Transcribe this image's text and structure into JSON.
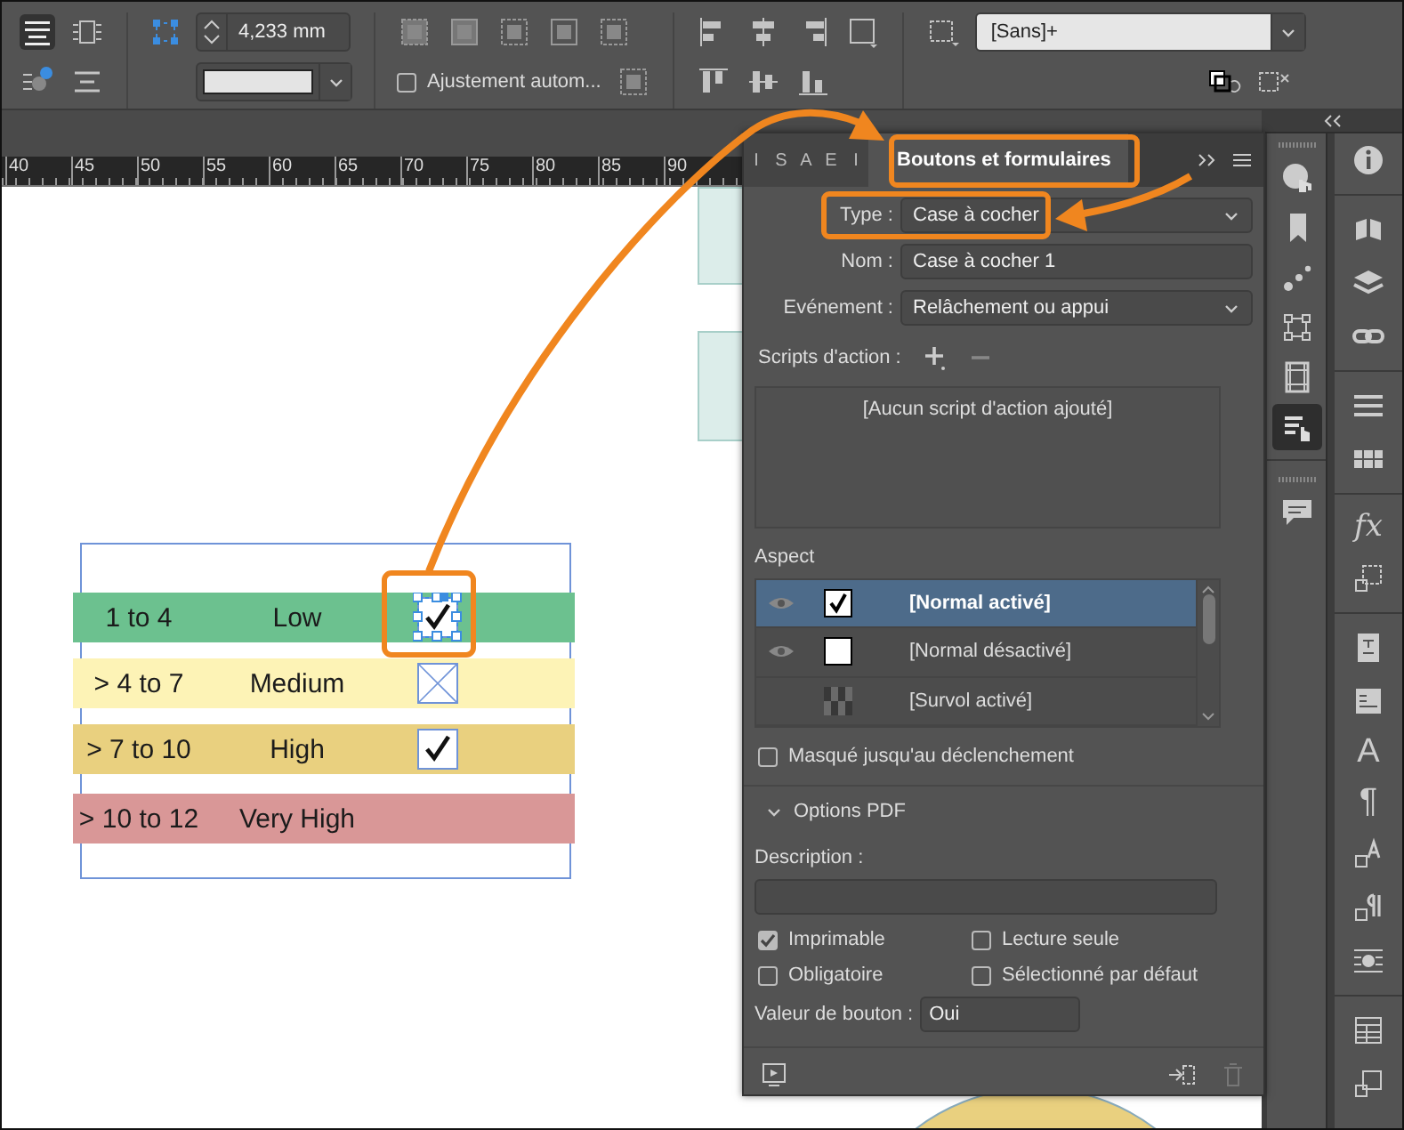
{
  "toolbar": {
    "stroke_weight": "4,233 mm",
    "auto_fit": {
      "label": "Ajustement autom...",
      "checked": false
    },
    "object_style": "[Sans]+"
  },
  "ruler": [
    "40",
    "45",
    "50",
    "55",
    "60",
    "65",
    "70",
    "75",
    "80",
    "85",
    "90"
  ],
  "canvas": {
    "rows": [
      {
        "range": "1 to 4",
        "rating": "Low",
        "color": "#6cc18f",
        "checkbox": {
          "checked": true,
          "selected": true
        }
      },
      {
        "range": "> 4 to 7",
        "rating": "Medium",
        "color": "#fdf3b6",
        "checkbox": {
          "checked": false,
          "selected": false
        }
      },
      {
        "range": "> 7 to 10",
        "rating": "High",
        "color": "#e9d07f",
        "checkbox": {
          "checked": true,
          "selected": false
        }
      },
      {
        "range": "> 10 to 12",
        "rating": "Very High",
        "color": "#d99797"
      }
    ]
  },
  "panel": {
    "tabs": [
      {
        "label": "I",
        "selected": false
      },
      {
        "label": "S",
        "selected": false
      },
      {
        "label": "A",
        "selected": false
      },
      {
        "label": "E",
        "selected": false
      },
      {
        "label": "I",
        "selected": false
      },
      {
        "label": "Boutons et formulaires",
        "selected": true
      }
    ],
    "fields": [
      {
        "kind": "dropdown",
        "label": "Type :",
        "value": "Case à cocher"
      },
      {
        "kind": "text",
        "label": "Nom :",
        "value": "Case à cocher 1"
      },
      {
        "kind": "dropdown",
        "label": "Evénement :",
        "value": "Relâchement ou appui"
      }
    ],
    "scripts": {
      "label": "Scripts d'action :",
      "empty_text": "[Aucun script d'action ajouté]"
    },
    "appearance": {
      "label": "Aspect",
      "states": [
        {
          "label": "[Normal activé]",
          "selected": true,
          "visible": true,
          "kind": "checked"
        },
        {
          "label": "[Normal désactivé]",
          "selected": false,
          "visible": true,
          "kind": "blank"
        },
        {
          "label": "[Survol activé]",
          "selected": false,
          "visible": false,
          "kind": "empty"
        }
      ]
    },
    "hidden_until_triggered": {
      "label": "Masqué jusqu'au déclenchement",
      "checked": false
    },
    "pdf_options": {
      "title": "Options PDF",
      "expanded": true,
      "description_label": "Description :",
      "options": [
        {
          "label": "Imprimable",
          "checked": true
        },
        {
          "label": "Lecture seule",
          "checked": false
        },
        {
          "label": "Obligatoire",
          "checked": false
        },
        {
          "label": "Sélectionné par défaut",
          "checked": false
        }
      ],
      "button_value": {
        "label": "Valeur de bouton :",
        "value": "Oui"
      }
    }
  },
  "dock": {
    "column_1": [
      {
        "selected": false
      },
      {
        "selected": false
      },
      {
        "selected": false
      },
      {
        "selected": false
      },
      {
        "selected": false
      },
      {
        "selected": true
      },
      {
        "selected": false
      }
    ],
    "glyphs": [
      "fx",
      "A",
      "¶"
    ]
  }
}
